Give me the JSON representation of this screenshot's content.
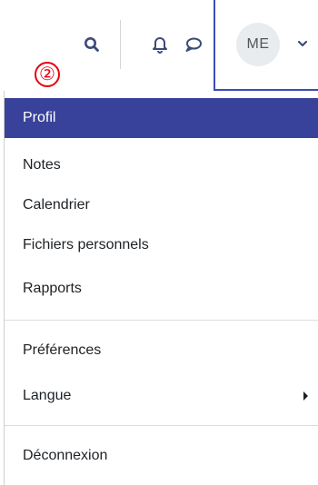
{
  "navbar": {
    "icons": {
      "search": "search-icon",
      "notifications": "bell-icon",
      "messages": "chat-bubble-icon",
      "user_menu_toggle": "chevron-down-icon"
    },
    "avatar_initials": "ME",
    "step_marker": "②"
  },
  "menu": {
    "items": [
      {
        "label": "Profil",
        "active": true
      },
      {
        "label": "Notes"
      },
      {
        "label": "Calendrier"
      },
      {
        "label": "Fichiers personnels"
      },
      {
        "label": "Rapports"
      },
      {
        "label": "Préférences"
      },
      {
        "label": "Langue",
        "has_submenu": true
      },
      {
        "label": "Déconnexion"
      }
    ]
  },
  "colors": {
    "active_bg": "#38429a",
    "highlight_border": "#3b4cb8",
    "icon_color": "#3c4a7a",
    "step_marker": "#e8000f"
  }
}
